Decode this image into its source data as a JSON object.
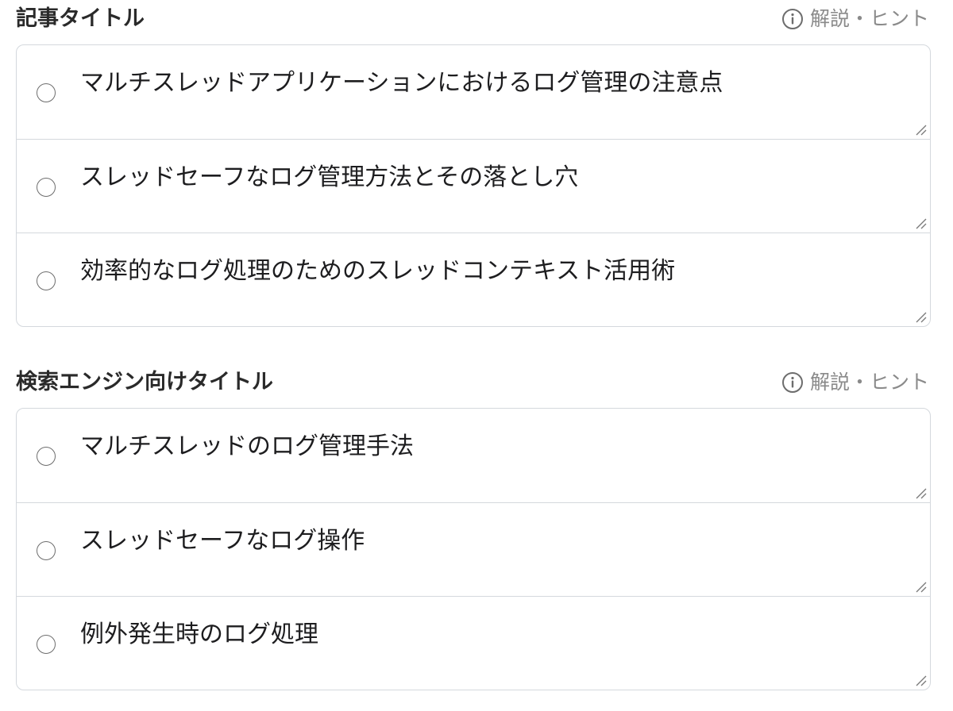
{
  "sections": [
    {
      "title": "記事タイトル",
      "hint_label": "解説・ヒント",
      "options": [
        {
          "text": "マルチスレッドアプリケーションにおけるログ管理の注意点",
          "selected": false
        },
        {
          "text": "スレッドセーフなログ管理方法とその落とし穴",
          "selected": false
        },
        {
          "text": "効率的なログ処理のためのスレッドコンテキスト活用術",
          "selected": false
        }
      ]
    },
    {
      "title": "検索エンジン向けタイトル",
      "hint_label": "解説・ヒント",
      "options": [
        {
          "text": "マルチスレッドのログ管理手法",
          "selected": false
        },
        {
          "text": "スレッドセーフなログ操作",
          "selected": false
        },
        {
          "text": "例外発生時のログ処理",
          "selected": false
        }
      ]
    }
  ],
  "icons": {
    "hint": "info-circle-icon",
    "radio": "radio-empty",
    "resize": "resize-handle-icon"
  },
  "colors": {
    "border": "#d4d8dd",
    "hint_text": "#8a8a8a",
    "title_text": "#2a2a2a",
    "radio_border": "#6d6d6d"
  }
}
